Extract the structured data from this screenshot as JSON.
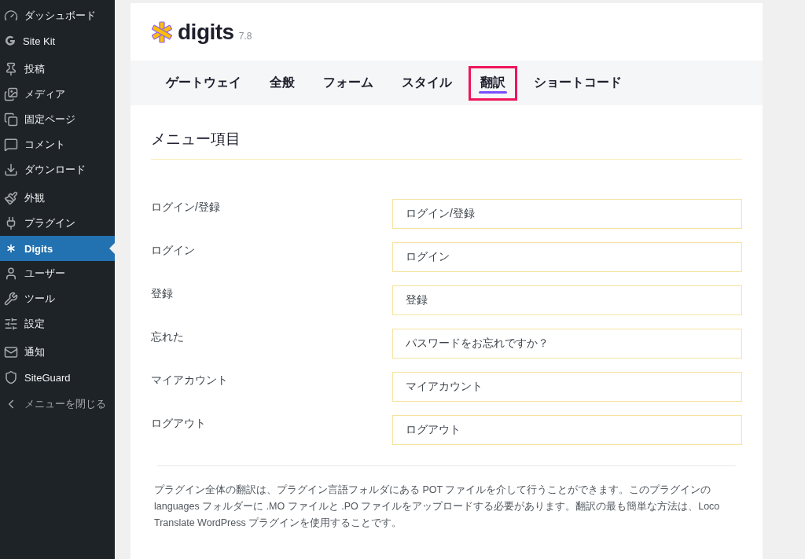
{
  "sidebar": {
    "items": [
      {
        "label": "ダッシュボード",
        "selected": false
      },
      {
        "label": "Site Kit",
        "selected": false
      },
      {
        "label": "投稿",
        "selected": false
      },
      {
        "label": "メディア",
        "selected": false
      },
      {
        "label": "固定ページ",
        "selected": false
      },
      {
        "label": "コメント",
        "selected": false
      },
      {
        "label": "ダウンロード",
        "selected": false
      },
      {
        "label": "外観",
        "selected": false
      },
      {
        "label": "プラグイン",
        "selected": false
      },
      {
        "label": "Digits",
        "selected": true
      },
      {
        "label": "ユーザー",
        "selected": false
      },
      {
        "label": "ツール",
        "selected": false
      },
      {
        "label": "設定",
        "selected": false
      },
      {
        "label": "通知",
        "selected": false
      },
      {
        "label": "SiteGuard",
        "selected": false
      }
    ],
    "collapse": "メニューを閉じる"
  },
  "header": {
    "logo": "digits",
    "version": "7.8"
  },
  "tabs": [
    {
      "label": "ゲートウェイ",
      "selected": false
    },
    {
      "label": "全般",
      "selected": false
    },
    {
      "label": "フォーム",
      "selected": false
    },
    {
      "label": "スタイル",
      "selected": false
    },
    {
      "label": "翻訳",
      "selected": true
    },
    {
      "label": "ショートコード",
      "selected": false
    }
  ],
  "section_title": "メニュー項目",
  "fields": [
    {
      "label": "ログイン/登録",
      "value": "ログイン/登録"
    },
    {
      "label": "ログイン",
      "value": "ログイン"
    },
    {
      "label": "登録",
      "value": "登録"
    },
    {
      "label": "忘れた",
      "value": "パスワードをお忘れですか？"
    },
    {
      "label": "マイアカウント",
      "value": "マイアカウント"
    },
    {
      "label": "ログアウト",
      "value": "ログアウト"
    }
  ],
  "note": "プラグイン全体の翻訳は、プラグイン言語フォルダにある POT ファイルを介して行うことができます。このプラグインの languages フォルダーに .MO ファイルと .PO ファイルをアップロードする必要があります。翻訳の最も簡単な方法は、Loco Translate WordPress プラグインを使用することです。"
}
